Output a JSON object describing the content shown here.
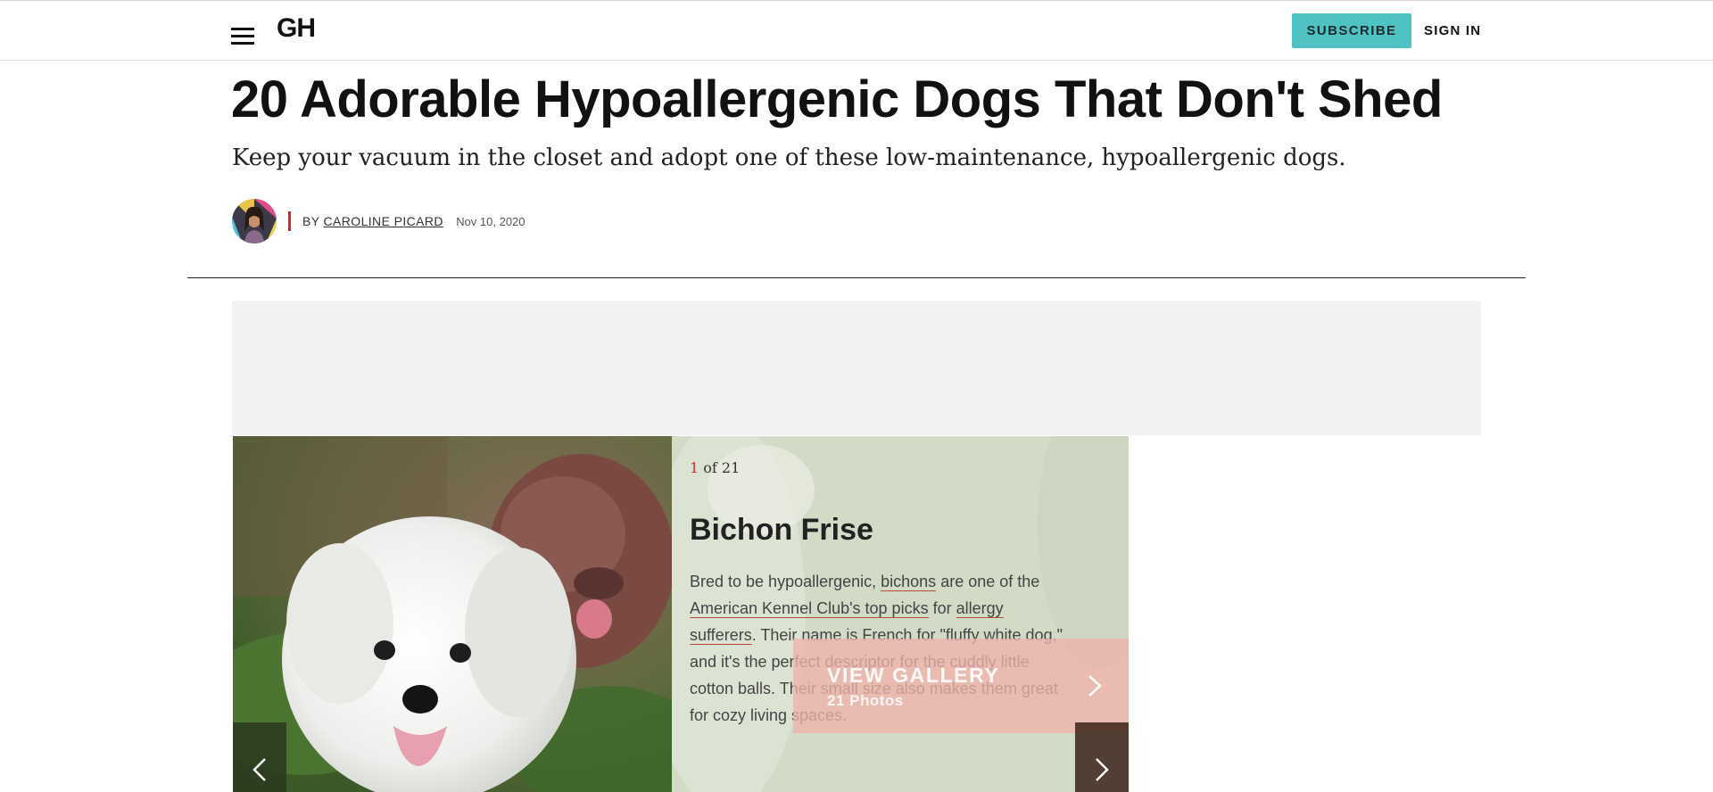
{
  "header": {
    "logo": "GH",
    "subscribe_label": "SUBSCRIBE",
    "signin_label": "SIGN IN",
    "accent_color": "#4fc3c3"
  },
  "article": {
    "headline": "20 Adorable Hypoallergenic Dogs That Don't Shed",
    "dek": "Keep your vacuum in the closet and adopt one of these low-maintenance, hypoallergenic dogs.",
    "byline_prefix": "BY",
    "author": "CAROLINE PICARD",
    "date": "Nov 10, 2020"
  },
  "gallery": {
    "counter_current": "1",
    "counter_rest": "of 21",
    "slide_title": "Bichon Frise",
    "body": {
      "t1": "Bred to be hypoallergenic, ",
      "link1": "bichons",
      "t2": " are one of the ",
      "link2": "American Kennel Club's top picks",
      "t3": " for ",
      "link3": "allergy sufferers",
      "t4": ". Their name is French for \"fluffy white dog,\" and it's the perfect descriptor for the cuddly little cotton balls. Their small size also makes them great for cozy living spaces."
    },
    "view_gallery_label": "VIEW GALLERY",
    "photo_count": "21 Photos",
    "icons": {
      "prev": "chevron-left-icon",
      "next": "chevron-right-icon",
      "menu": "hamburger-menu-icon"
    }
  }
}
